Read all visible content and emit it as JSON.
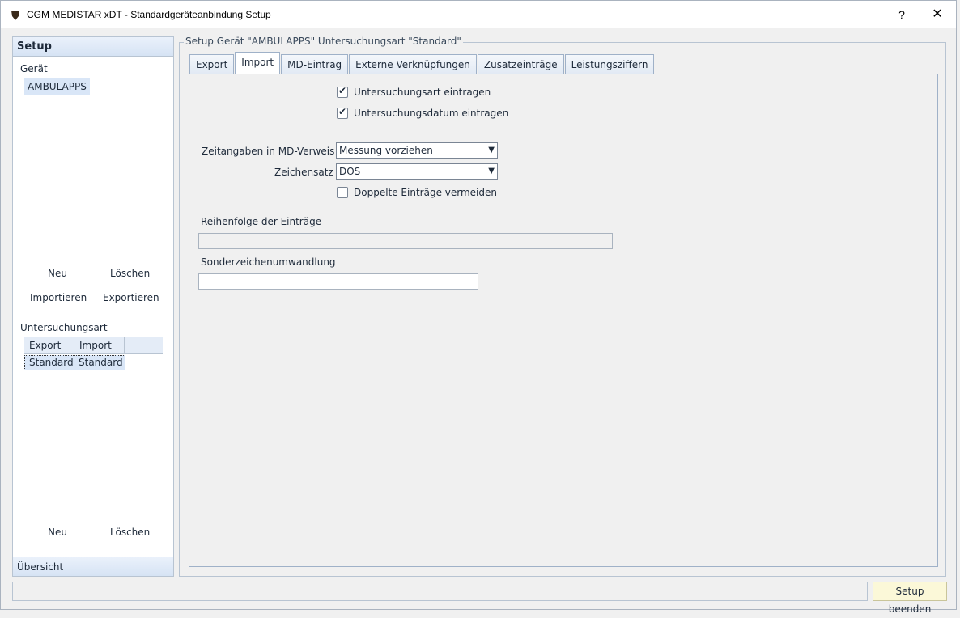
{
  "window": {
    "title": "CGM MEDISTAR xDT - Standardgeräteanbindung  Setup",
    "help_label": "?",
    "close_label": "✕"
  },
  "left_panel": {
    "header": "Setup",
    "device_label": "Gerät",
    "device_items": [
      "AMBULAPPS"
    ],
    "device_new": "Neu",
    "device_delete": "Löschen",
    "import_label": "Importieren",
    "export_label": "Exportieren",
    "exam_type_label": "Untersuchungsart",
    "exam_grid": {
      "columns": [
        "Export",
        "Import"
      ],
      "rows": [
        [
          "Standard",
          "Standard"
        ]
      ]
    },
    "exam_new": "Neu",
    "exam_delete": "Löschen",
    "footer": "Übersicht"
  },
  "main": {
    "group_title": "Setup Gerät \"AMBULAPPS\" Untersuchungsart \"Standard\"",
    "tabs": [
      {
        "label": "Export",
        "active": false
      },
      {
        "label": "Import",
        "active": true
      },
      {
        "label": "MD-Eintrag",
        "active": false
      },
      {
        "label": "Externe Verknüpfungen",
        "active": false
      },
      {
        "label": "Zusatzeinträge",
        "active": false
      },
      {
        "label": "Leistungsziffern",
        "active": false
      }
    ],
    "import_tab": {
      "chk_exam_type": {
        "label": "Untersuchungsart eintragen",
        "checked": true
      },
      "chk_exam_date": {
        "label": "Untersuchungsdatum eintragen",
        "checked": true
      },
      "time_label": "Zeitangaben in MD-Verweis",
      "time_value": "Messung vorziehen",
      "charset_label": "Zeichensatz",
      "charset_value": "DOS",
      "chk_duplicates": {
        "label": "Doppelte Einträge vermeiden",
        "checked": false
      },
      "order_label": "Reihenfolge der Einträge",
      "order_value": "",
      "special_label": "Sonderzeichenumwandlung",
      "special_value": ""
    }
  },
  "statusbar": {
    "text": "",
    "finish_label": "Setup beenden"
  }
}
